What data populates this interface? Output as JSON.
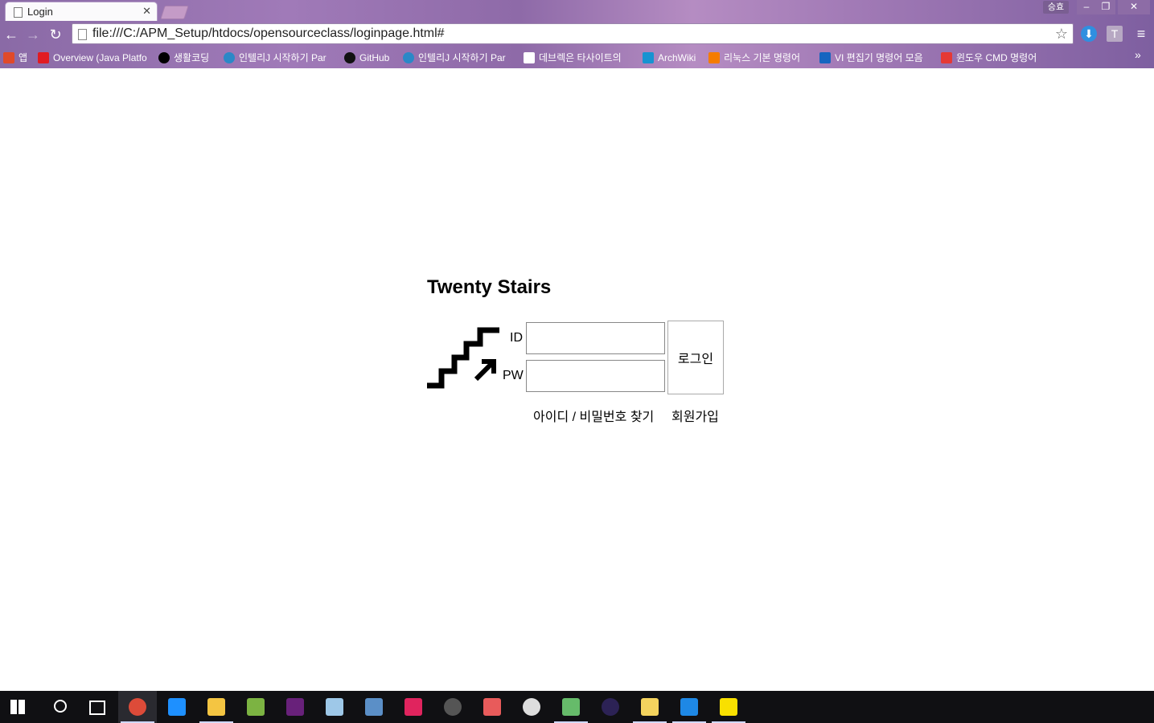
{
  "browser": {
    "tab_title": "Login",
    "profile_label": "승효",
    "url": "file:///C:/APM_Setup/htdocs/opensourceclass/loginpage.html#",
    "ext_letter": "T"
  },
  "bookmarks": [
    {
      "label": "앱",
      "icon": "apps-icon",
      "color": "#e04a2a"
    },
    {
      "label": "Overview (Java Platfo",
      "icon": "oracle-icon",
      "color": "#e11b22"
    },
    {
      "label": "생활코딩",
      "icon": "dot-icon",
      "color": "#000000"
    },
    {
      "label": "인텔리J 시작하기 Par",
      "icon": "wordpress-icon",
      "color": "#2b88c7"
    },
    {
      "label": "GitHub",
      "icon": "github-icon",
      "color": "#111111"
    },
    {
      "label": "인텔리J 시작하기 Par",
      "icon": "wordpress-icon",
      "color": "#2b88c7"
    },
    {
      "label": "데브렉은 타사이트의",
      "icon": "page-icon",
      "color": "#ffffff"
    },
    {
      "label": "ArchWiki",
      "icon": "arch-icon",
      "color": "#1793d1"
    },
    {
      "label": "리눅스 기본 명령어",
      "icon": "m-icon",
      "color": "#f57c00"
    },
    {
      "label": "VI 편집기 명령어 모음",
      "icon": "exclaim-icon",
      "color": "#1565c0"
    },
    {
      "label": "윈도우 CMD 명령어",
      "icon": "z-icon",
      "color": "#e53935"
    }
  ],
  "page": {
    "title": "Twenty Stairs",
    "id_label": "ID",
    "pw_label": "PW",
    "id_value": "",
    "pw_value": "",
    "login_button": "로그인",
    "find_link": "아이디 / 비밀번호 찾기",
    "join_link": "회원가입"
  },
  "taskbar": [
    {
      "name": "start-icon"
    },
    {
      "name": "search-icon"
    },
    {
      "name": "task-view-icon"
    },
    {
      "name": "chrome-icon",
      "active": true
    },
    {
      "name": "ie-icon"
    },
    {
      "name": "file-explorer-icon"
    },
    {
      "name": "android-studio-icon"
    },
    {
      "name": "visual-studio-icon"
    },
    {
      "name": "app-icon"
    },
    {
      "name": "virtualbox-icon"
    },
    {
      "name": "intellij-icon"
    },
    {
      "name": "apm-icon"
    },
    {
      "name": "app-red-icon"
    },
    {
      "name": "unity-icon"
    },
    {
      "name": "atom-icon"
    },
    {
      "name": "eclipse-icon"
    },
    {
      "name": "folder-icon"
    },
    {
      "name": "edge-icon"
    },
    {
      "name": "kakaotalk-icon"
    }
  ]
}
